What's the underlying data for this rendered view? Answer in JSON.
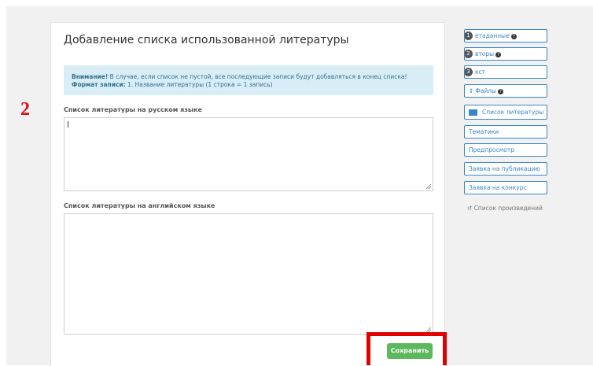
{
  "step_marker": "2",
  "form": {
    "title": "Добавление списка использованной литературы",
    "notice": {
      "line1_bold": "Внимание!",
      "line1_text": " В случае, если список не пустой, все последующие записи будут добавляться в конец списка!",
      "line2_bold": "Формат записи:",
      "line2_text": " 1. Название литературы (1 строка = 1 запись)"
    },
    "ru_label": "Список литературы на русском языке",
    "ru_value": "",
    "en_label": "Список литературы на английском языке",
    "en_value": "",
    "save_label": "Сохранить"
  },
  "sidebar": {
    "items": [
      {
        "label": "етаданные",
        "badge": "1",
        "help": "?"
      },
      {
        "label": "вторы",
        "badge": "2",
        "help": "?"
      },
      {
        "label": "кст",
        "badge": "3"
      },
      {
        "label": "Файлы",
        "help": "?"
      },
      {
        "label": "Список литературы"
      },
      {
        "label": "Тематики"
      },
      {
        "label": "Предпросмотр"
      },
      {
        "label": "Заявка на публикацию"
      },
      {
        "label": "Заявка на конкурс"
      }
    ],
    "works_link": "Список произведений"
  },
  "colors": {
    "accent": "#3a87c7",
    "save_button": "#5cb85c",
    "highlight_frame": "#e00000",
    "notice_bg": "#d9edf7"
  }
}
